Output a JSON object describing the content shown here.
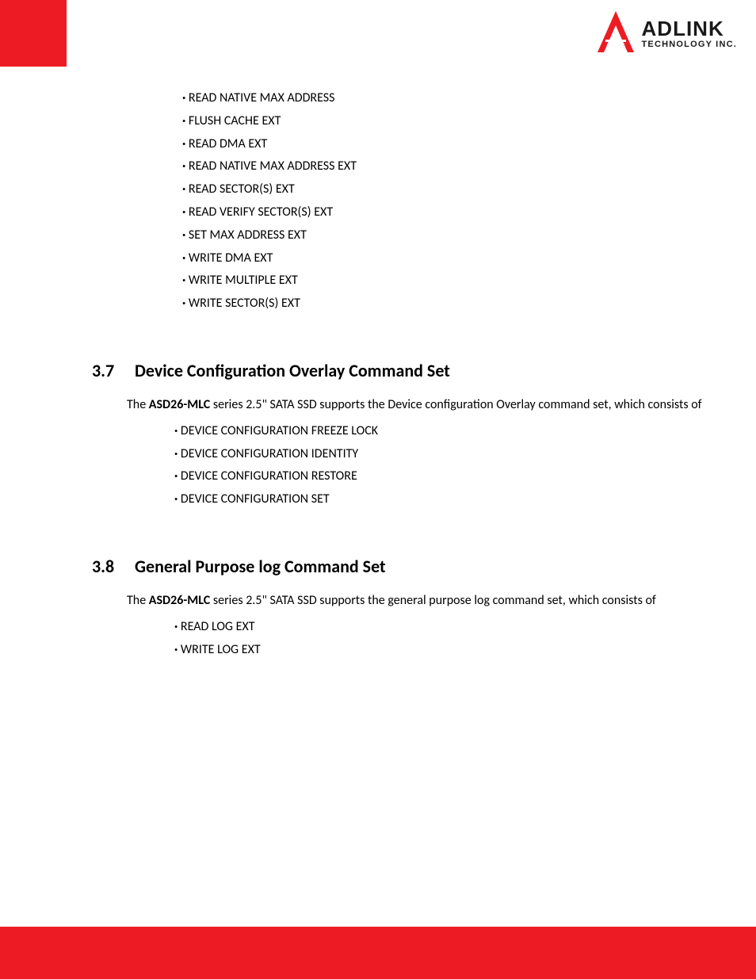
{
  "logo": {
    "top": "ADLINK",
    "bottom": "TECHNOLOGY INC."
  },
  "top_list": [
    "READ NATIVE MAX ADDRESS",
    "FLUSH CACHE EXT",
    "READ DMA EXT",
    "READ NATIVE MAX ADDRESS EXT",
    "READ SECTOR(S) EXT",
    "READ VERIFY SECTOR(S) EXT",
    "SET MAX ADDRESS EXT",
    "WRITE DMA EXT",
    "WRITE MULTIPLE EXT",
    "WRITE SECTOR(S) EXT"
  ],
  "section37": {
    "num": "3.7",
    "title": "Device Configuration Overlay Command Set",
    "body_pre": "The ",
    "body_bold": "ASD26-MLC",
    "body_post": " series 2.5\" SATA SSD supports the Device configuration Overlay command set, which consists of",
    "items": [
      "DEVICE CONFIGURATION FREEZE LOCK",
      "DEVICE CONFIGURATION IDENTITY",
      "DEVICE CONFIGURATION RESTORE",
      "DEVICE CONFIGURATION SET"
    ]
  },
  "section38": {
    "num": "3.8",
    "title": "General Purpose log Command Set",
    "body_pre": "The ",
    "body_bold": "ASD26-MLC",
    "body_post": " series 2.5\" SATA SSD supports the general purpose log command set, which consists of",
    "items": [
      "READ LOG EXT",
      "WRITE LOG EXT"
    ]
  }
}
